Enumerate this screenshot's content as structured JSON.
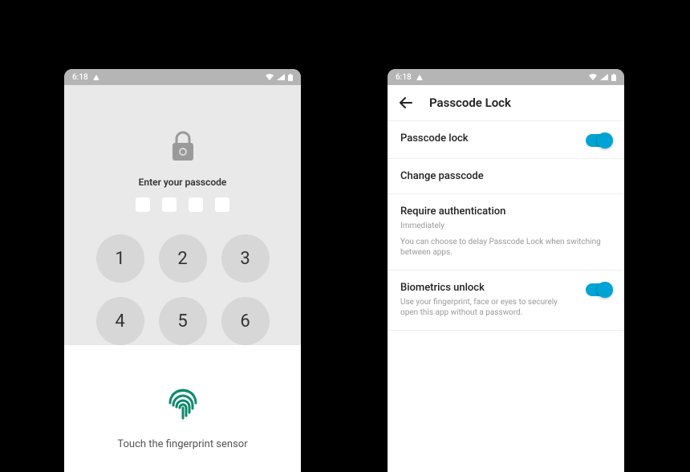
{
  "status": {
    "time": "6:18"
  },
  "left": {
    "prompt": "Enter your passcode",
    "keys": [
      "1",
      "2",
      "3",
      "4",
      "5",
      "6"
    ],
    "fingerprint_prompt": "Touch the fingerprint sensor"
  },
  "right": {
    "header_title": "Passcode Lock",
    "rows": {
      "passcode_lock": {
        "title": "Passcode lock"
      },
      "change_passcode": {
        "title": "Change passcode"
      },
      "require_auth": {
        "title": "Require authentication",
        "subtitle": "Immediately",
        "description": "You can choose to delay Passcode Lock when switching between apps."
      },
      "biometrics": {
        "title": "Biometrics unlock",
        "description": "Use your fingerprint, face or eyes to securely open this app without a password."
      }
    }
  }
}
